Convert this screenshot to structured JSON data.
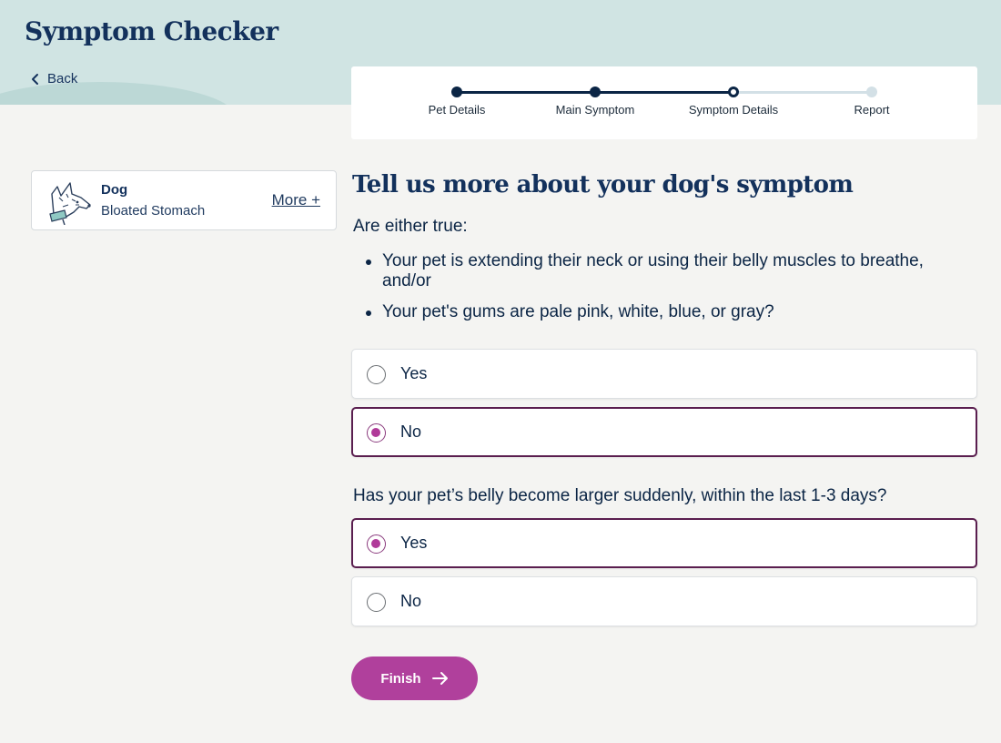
{
  "header": {
    "title": "Symptom Checker",
    "back_label": "Back"
  },
  "progress": {
    "steps": [
      {
        "label": "Pet Details",
        "state": "done"
      },
      {
        "label": "Main Symptom",
        "state": "done"
      },
      {
        "label": "Symptom Details",
        "state": "current"
      },
      {
        "label": "Report",
        "state": "todo"
      }
    ]
  },
  "pet": {
    "name": "Dog",
    "symptom": "Bloated Stomach",
    "more_label": "More +"
  },
  "main": {
    "heading": "Tell us more about your dog's symptom",
    "question1": {
      "text": "Are either true:",
      "bullets": [
        "Your pet is extending their neck or using their belly muscles to breathe, and/or",
        "Your pet's gums are pale pink, white, blue, or gray?"
      ],
      "options": [
        {
          "label": "Yes",
          "selected": false
        },
        {
          "label": "No",
          "selected": true
        }
      ]
    },
    "question2": {
      "text": "Has your pet’s belly become larger suddenly, within the last 1-3 days?",
      "options": [
        {
          "label": "Yes",
          "selected": true
        },
        {
          "label": "No",
          "selected": false
        }
      ]
    },
    "finish_label": "Finish"
  },
  "colors": {
    "accent": "#b0409c",
    "navy": "#0b2545",
    "header_bg": "#d0e4e3"
  }
}
